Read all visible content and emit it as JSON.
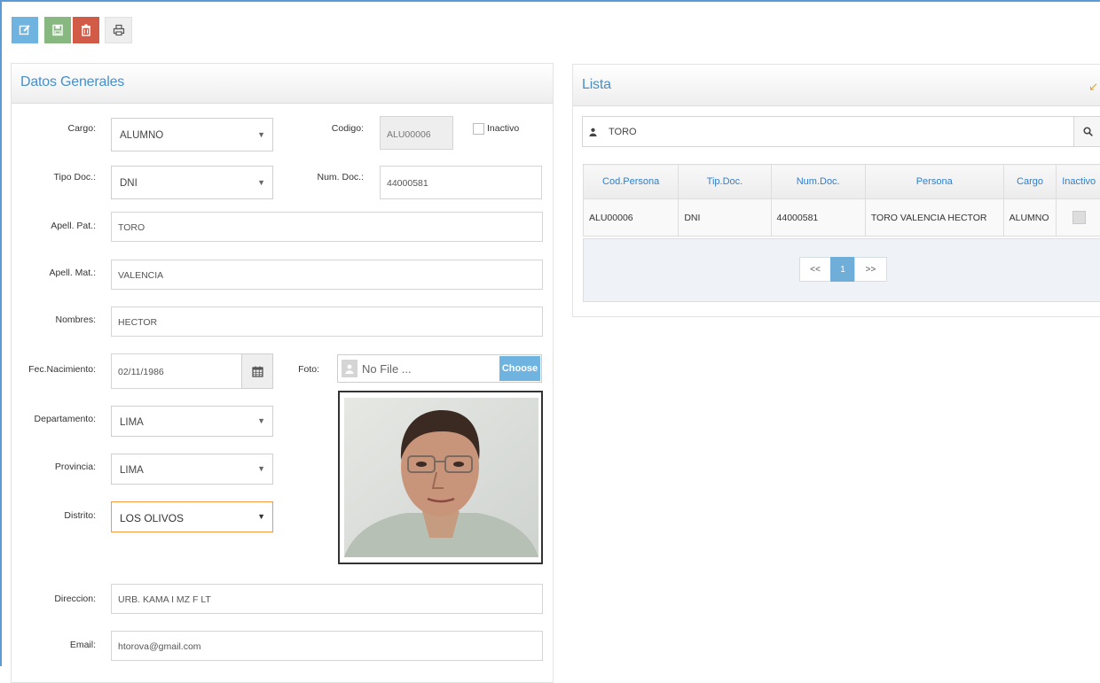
{
  "toolbar": {
    "edit_icon": "edit-icon",
    "save_icon": "save-icon",
    "delete_icon": "trash-icon",
    "print_icon": "print-icon",
    "colors": {
      "edit": "#6fb3e0",
      "save": "#87b87f",
      "delete": "#d15b47",
      "print": "#eeeeee"
    }
  },
  "general": {
    "title": "Datos Generales",
    "cargo_label": "Cargo:",
    "cargo_value": "ALUMNO",
    "codigo_label": "Codigo:",
    "codigo_value": "ALU00006",
    "inactivo_label": "Inactivo",
    "tipo_doc_label": "Tipo Doc.:",
    "tipo_doc_value": "DNI",
    "num_doc_label": "Num. Doc.:",
    "num_doc_value": "44000581",
    "apell_pat_label": "Apell. Pat.:",
    "apell_pat_value": "TORO",
    "apell_mat_label": "Apell. Mat.:",
    "apell_mat_value": "VALENCIA",
    "nombres_label": "Nombres:",
    "nombres_value": "HECTOR",
    "fec_nac_label": "Fec.Nacimiento:",
    "fec_nac_value": "02/11/1986",
    "foto_label": "Foto:",
    "foto_placeholder": "No File ...",
    "choose_label": "Choose",
    "departamento_label": "Departamento:",
    "departamento_value": "LIMA",
    "provincia_label": "Provincia:",
    "provincia_value": "LIMA",
    "distrito_label": "Distrito:",
    "distrito_value": "LOS OLIVOS",
    "direccion_label": "Direccion:",
    "direccion_value": "URB. KAMA I MZ F LT",
    "email_label": "Email:",
    "email_value": "htorova@gmail.com"
  },
  "lista": {
    "title": "Lista",
    "search_value": "TORO",
    "columns": [
      "Cod.Persona",
      "Tip.Doc.",
      "Num.Doc.",
      "Persona",
      "Cargo",
      "Inactivo"
    ],
    "rows": [
      {
        "cod": "ALU00006",
        "tipdoc": "DNI",
        "numdoc": "44000581",
        "persona": "TORO VALENCIA HECTOR",
        "cargo": "ALUMNO"
      }
    ],
    "pagination": {
      "prev": "<<",
      "page": "1",
      "next": ">>"
    }
  }
}
